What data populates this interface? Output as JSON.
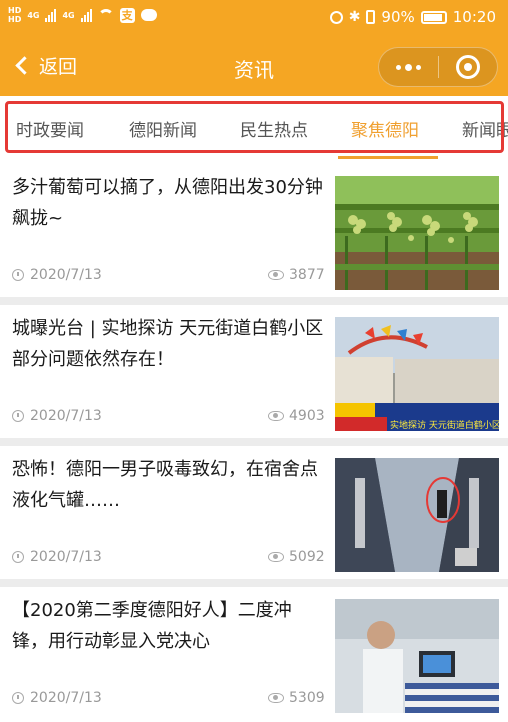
{
  "status": {
    "battery": "90%",
    "time": "10:20",
    "hd": "HD",
    "net": "4G",
    "alipay_glyph": "支"
  },
  "nav": {
    "back_label": "返回",
    "title": "资讯"
  },
  "tabs": [
    {
      "label": "时政要闻",
      "active": false
    },
    {
      "label": "德阳新闻",
      "active": false
    },
    {
      "label": "民生热点",
      "active": false
    },
    {
      "label": "聚焦德阳",
      "active": true
    },
    {
      "label": "新闻眼",
      "active": false
    }
  ],
  "articles": [
    {
      "title": "多汁葡萄可以摘了，从德阳出发30分钟飙拢~",
      "date": "2020/7/13",
      "views": "3877"
    },
    {
      "title": "城曝光台 | 实地探访 天元街道白鹤小区部分问题依然存在！",
      "date": "2020/7/13",
      "views": "4903",
      "thumb_caption": "实地探访 天元街道白鹤小区部分问题依然存"
    },
    {
      "title": "恐怖！德阳一男子吸毒致幻，在宿舍点液化气罐……",
      "date": "2020/7/13",
      "views": "5092"
    },
    {
      "title": "【2020第二季度德阳好人】二度冲锋，用行动彰显入党决心",
      "date": "2020/7/13",
      "views": "5309"
    }
  ],
  "colors": {
    "header": "#f5a623",
    "accent": "#f0a030",
    "highlight": "#e53935"
  }
}
